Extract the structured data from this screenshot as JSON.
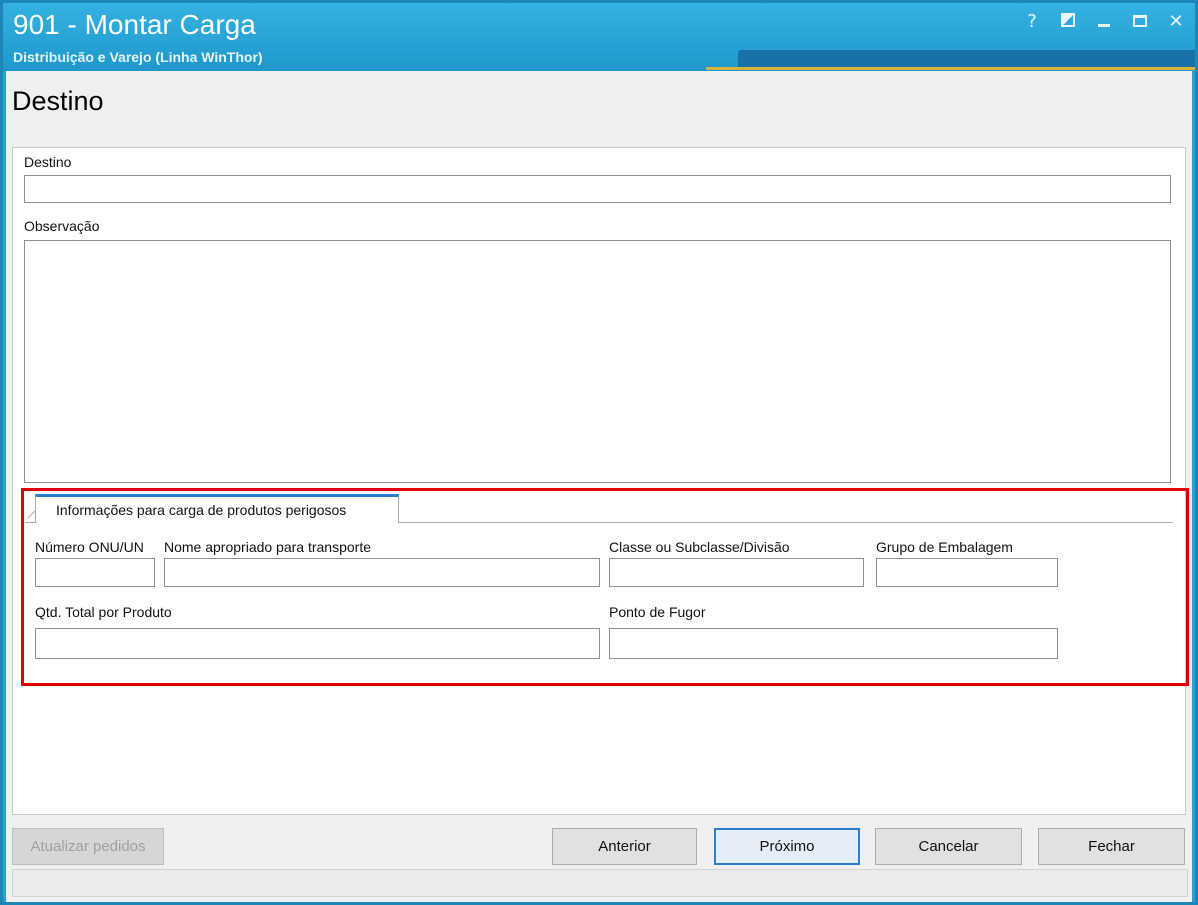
{
  "window": {
    "title": "901 - Montar Carga",
    "subtitle": "Distribuição e Varejo (Linha WinThor)",
    "controls": {
      "help": "?",
      "restore_icon": "restore-icon",
      "minimize_icon": "minimize-icon",
      "maximize_icon": "maximize-icon",
      "close": "✕"
    }
  },
  "page": {
    "heading": "Destino"
  },
  "form": {
    "destino_label": "Destino",
    "destino_value": "",
    "observacao_label": "Observação",
    "observacao_value": ""
  },
  "dangerous_goods": {
    "tab_label": "Informações para carga de produtos perigosos",
    "onu_label": "Número ONU/UN",
    "nome_label": "Nome apropriado para transporte",
    "classe_label": "Classe ou Subclasse/Divisão",
    "grupo_label": "Grupo de Embalagem",
    "qtd_label": "Qtd. Total por Produto",
    "ponto_label": "Ponto de Fugor",
    "onu_value": "",
    "nome_value": "",
    "classe_value": "",
    "grupo_value": "",
    "qtd_value": "",
    "ponto_value": ""
  },
  "buttons": {
    "atualizar": "Atualizar pedidos",
    "anterior": "Anterior",
    "proximo": "Próximo",
    "cancelar": "Cancelar",
    "fechar": "Fechar"
  },
  "colors": {
    "title_bar": "#2a9fd0",
    "highlight": "#e00000",
    "tab_accent": "#2a7dd1"
  }
}
